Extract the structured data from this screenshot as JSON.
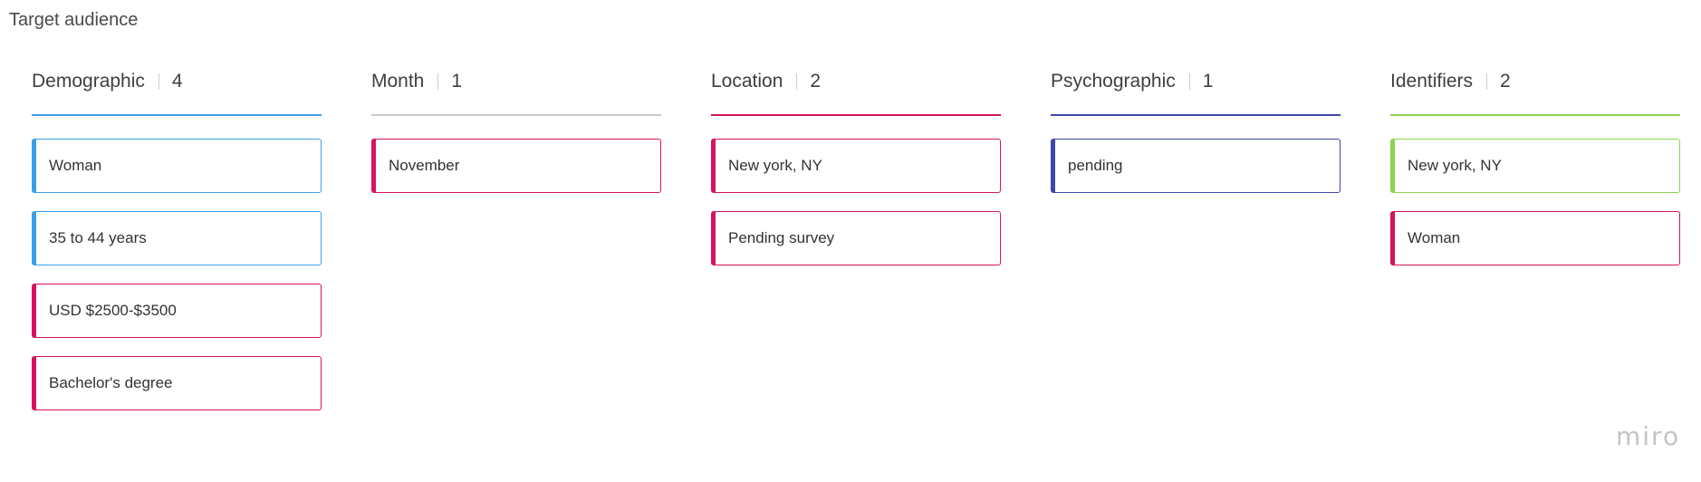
{
  "board": {
    "title": "Target audience",
    "watermark": "miro"
  },
  "columns": [
    {
      "name": "Demographic",
      "count": "4",
      "color": "#3b9ee8",
      "cards": [
        {
          "label": "Woman",
          "color": "#3b9ee8"
        },
        {
          "label": "35 to 44 years",
          "color": "#3b9ee8"
        },
        {
          "label": "USD $2500-$3500",
          "color": "#d6135f"
        },
        {
          "label": "Bachelor's degree",
          "color": "#d6135f"
        }
      ]
    },
    {
      "name": "Month",
      "count": "1",
      "color": "#c8c8c8",
      "cards": [
        {
          "label": "November",
          "color": "#d6135f"
        }
      ]
    },
    {
      "name": "Location",
      "count": "2",
      "color": "#d6135f",
      "cards": [
        {
          "label": "New york, NY",
          "color": "#d6135f"
        },
        {
          "label": "Pending survey",
          "color": "#d6135f"
        }
      ]
    },
    {
      "name": "Psychographic",
      "count": "1",
      "color": "#3f46ad",
      "cards": [
        {
          "label": "pending",
          "color": "#3f46ad"
        }
      ]
    },
    {
      "name": "Identifiers",
      "count": "2",
      "color": "#8cd34e",
      "cards": [
        {
          "label": "New york, NY",
          "color": "#8cd34e"
        },
        {
          "label": "Woman",
          "color": "#d6135f"
        }
      ]
    }
  ]
}
